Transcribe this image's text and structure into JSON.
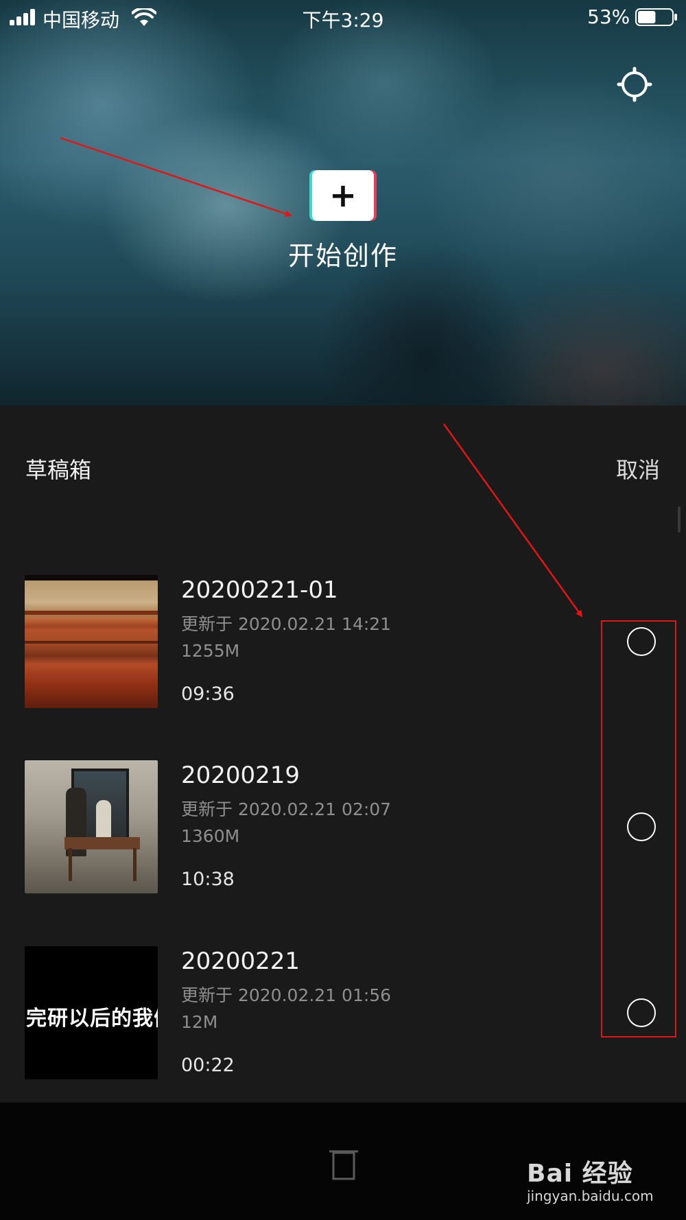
{
  "status_bar": {
    "carrier": "中国移动",
    "time": "下午3:29",
    "battery_percent": "53%",
    "battery_level": 0.53
  },
  "hero": {
    "create_label": "开始创作",
    "create_icon": "plus-icon",
    "settings_icon": "settings-gear-icon"
  },
  "drafts": {
    "title": "草稿箱",
    "cancel_label": "取消",
    "items": [
      {
        "name": "20200221-01",
        "updated": "更新于 2020.02.21 14:21",
        "size": "1255M",
        "duration": "09:36",
        "selected": false
      },
      {
        "name": "20200219",
        "updated": "更新于 2020.02.21 02:07",
        "size": "1360M",
        "duration": "10:38",
        "selected": false
      },
      {
        "name": "20200221",
        "updated": "更新于 2020.02.21 01:56",
        "size": "12M",
        "duration": "00:22",
        "selected": false,
        "thumbnail_text": "完研以后的我们"
      }
    ]
  },
  "bottom_bar": {
    "delete_icon": "trash-icon"
  },
  "watermark": {
    "brand": "Bai 经验",
    "site": "jingyan.baidu.com"
  },
  "annotation_color": "#e11616",
  "accent_colors": {
    "cyan": "#3fd6d0",
    "pink": "#ec3b5b"
  }
}
